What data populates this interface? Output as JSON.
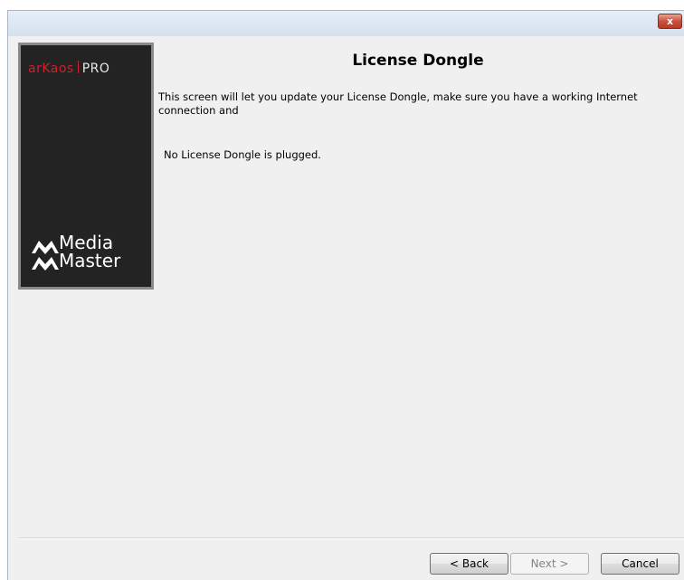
{
  "window": {
    "close_label": "x"
  },
  "banner": {
    "brand_top": {
      "red": "arKaos",
      "pro": "PRO"
    },
    "product": "Media\nMaster"
  },
  "content": {
    "title": "License Dongle",
    "description": "This screen will let you update your License Dongle, make sure you have a working Internet connection and",
    "status": "No License Dongle is plugged."
  },
  "buttons": {
    "back": "< Back",
    "next": "Next >",
    "cancel": "Cancel"
  },
  "colors": {
    "brand_red": "#d41f2b",
    "close_red": "#c7523b"
  }
}
